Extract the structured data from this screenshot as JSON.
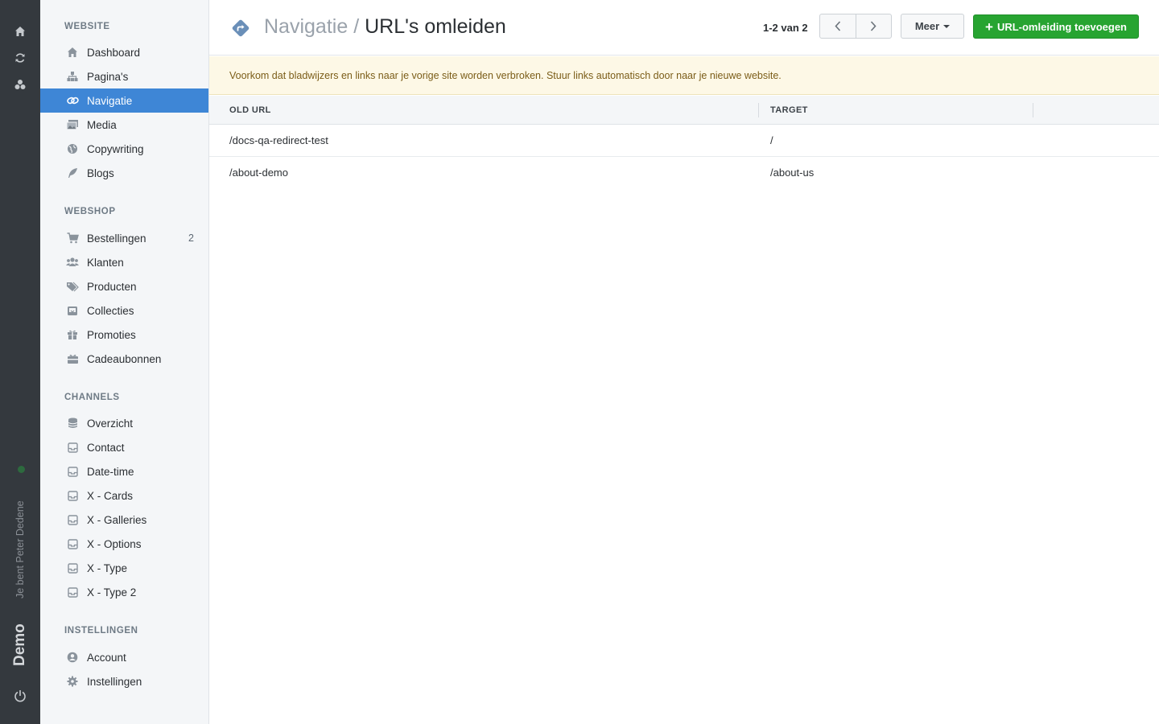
{
  "rail": {
    "user_text": "Je bent Peter Dedene",
    "brand": "Demo",
    "status_color": "#2d6a3e"
  },
  "sidebar": {
    "sections": {
      "website": "WEBSITE",
      "webshop": "WEBSHOP",
      "channels": "CHANNELS",
      "settings": "INSTELLINGEN"
    },
    "website_items": [
      {
        "label": "Dashboard",
        "icon": "home-icon"
      },
      {
        "label": "Pagina's",
        "icon": "sitemap-icon"
      },
      {
        "label": "Navigatie",
        "icon": "link-icon",
        "active": true
      },
      {
        "label": "Media",
        "icon": "images-icon"
      },
      {
        "label": "Copywriting",
        "icon": "globe-icon"
      },
      {
        "label": "Blogs",
        "icon": "feather-icon"
      }
    ],
    "webshop_items": [
      {
        "label": "Bestellingen",
        "icon": "cart-icon",
        "badge": "2"
      },
      {
        "label": "Klanten",
        "icon": "users-icon"
      },
      {
        "label": "Producten",
        "icon": "tags-icon"
      },
      {
        "label": "Collecties",
        "icon": "collection-icon"
      },
      {
        "label": "Promoties",
        "icon": "gift-icon"
      },
      {
        "label": "Cadeaubonnen",
        "icon": "gift-card-icon"
      }
    ],
    "channels_items": [
      {
        "label": "Overzicht",
        "icon": "database-icon"
      },
      {
        "label": "Contact",
        "icon": "inbox-icon"
      },
      {
        "label": "Date-time",
        "icon": "inbox-icon"
      },
      {
        "label": "X - Cards",
        "icon": "inbox-icon"
      },
      {
        "label": "X - Galleries",
        "icon": "inbox-icon"
      },
      {
        "label": "X - Options",
        "icon": "inbox-icon"
      },
      {
        "label": "X - Type",
        "icon": "inbox-icon"
      },
      {
        "label": "X - Type 2",
        "icon": "inbox-icon"
      }
    ],
    "settings_items": [
      {
        "label": "Account",
        "icon": "user-circle-icon"
      },
      {
        "label": "Instellingen",
        "icon": "gear-icon"
      }
    ]
  },
  "header": {
    "crumb": "Navigatie",
    "separator": "/",
    "title": "URL's omleiden",
    "pager_text": "1-2 van 2",
    "more_label": "Meer",
    "add_label": "URL-omleiding toevoegen",
    "add_color": "#27a431"
  },
  "notice": "Voorkom dat bladwijzers en links naar je vorige site worden verbroken. Stuur links automatisch door naar je nieuwe website.",
  "table": {
    "columns": [
      "OLD URL",
      "TARGET"
    ],
    "rows": [
      {
        "old_url": "/docs-qa-redirect-test",
        "target": "/"
      },
      {
        "old_url": "/about-demo",
        "target": "/about-us"
      }
    ]
  },
  "accent_color": "#3e86d6"
}
